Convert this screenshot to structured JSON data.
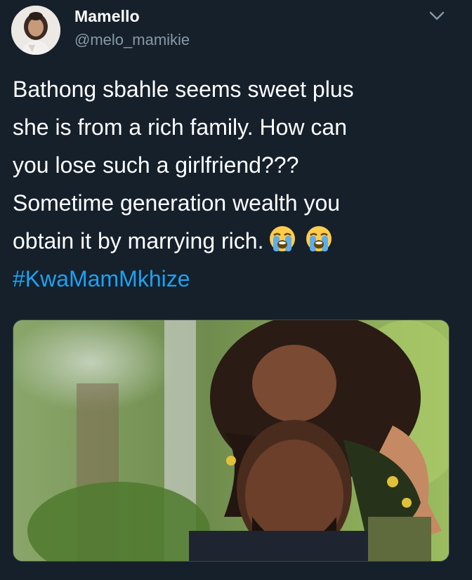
{
  "user": {
    "display_name": "Mamello",
    "handle": "@melo_mamikie"
  },
  "tweet": {
    "lines": [
      "Bathong sbahle seems sweet plus",
      "she is from a rich family. How can",
      "you lose such a girlfriend???",
      "Sometime generation wealth you",
      "obtain it by marrying rich."
    ],
    "emojis": [
      "loudly-crying-face",
      "loudly-crying-face"
    ],
    "hashtag": "#KwaMamMkhize"
  },
  "colors": {
    "background": "#15202b",
    "text": "#ffffff",
    "secondary": "#8899a6",
    "link": "#1da1f2"
  },
  "icons": {
    "menu": "chevron-down-icon"
  }
}
